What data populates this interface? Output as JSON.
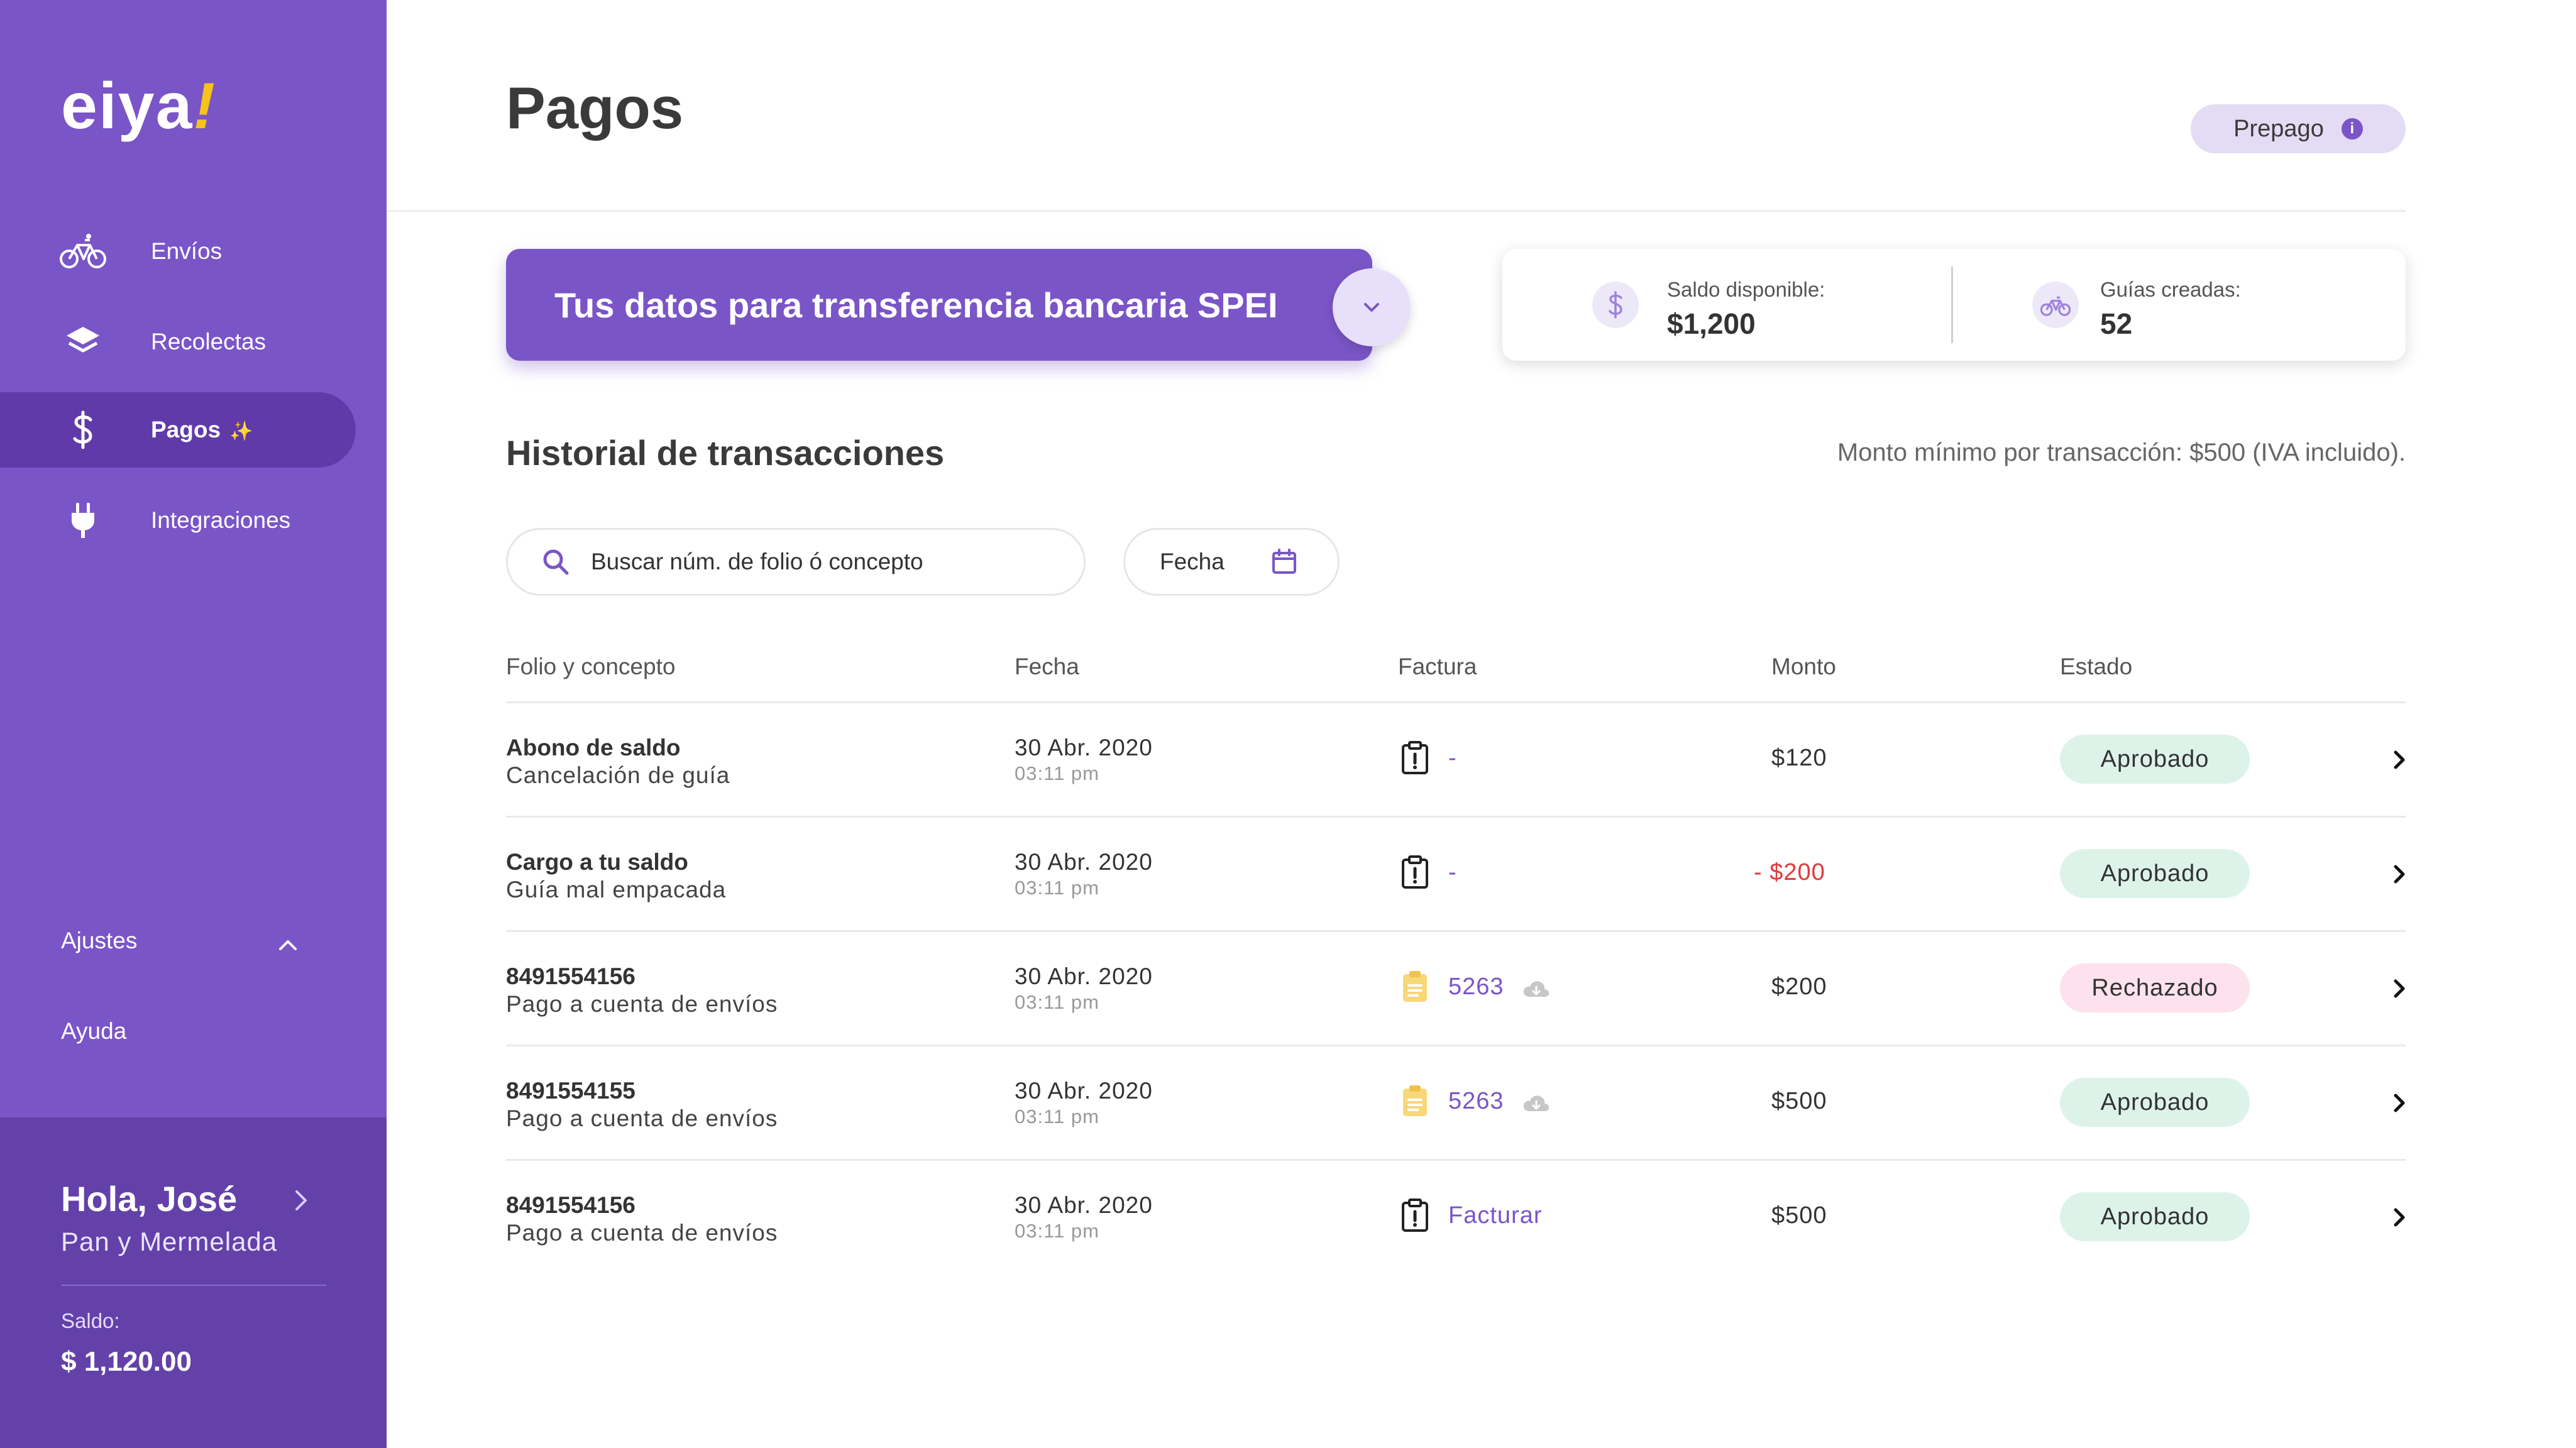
{
  "brand": {
    "logo_text": "eiya",
    "logo_mark": "!"
  },
  "sidebar": {
    "items": [
      {
        "label": "Envíos",
        "icon": "bicycle-icon",
        "active": false
      },
      {
        "label": "Recolectas",
        "icon": "layers-icon",
        "active": false
      },
      {
        "label": "Pagos",
        "icon": "dollar-icon",
        "active": true,
        "badge": "✨"
      },
      {
        "label": "Integraciones",
        "icon": "plug-icon",
        "active": false
      }
    ],
    "settings_label": "Ajustes",
    "help_label": "Ayuda",
    "user": {
      "greeting": "Hola, José",
      "company": "Pan y Mermelada",
      "balance_label": "Saldo:",
      "balance_value": "$ 1,120.00"
    }
  },
  "header": {
    "title": "Pagos",
    "plan_label": "Prepago",
    "plan_info": "i"
  },
  "spei": {
    "label": "Tus datos para transferencia bancaria SPEI"
  },
  "stats": {
    "balance_label": "Saldo disponible:",
    "balance_value": "$1,200",
    "guides_label": "Guías creadas:",
    "guides_value": "52"
  },
  "history": {
    "title": "Historial de transacciones",
    "min_note": "Monto mínimo por transacción: $500 (IVA incluido).",
    "search_placeholder": "Buscar núm. de folio ó concepto",
    "date_filter_label": "Fecha",
    "columns": [
      "Folio y concepto",
      "Fecha",
      "Factura",
      "Monto",
      "Estado"
    ],
    "rows": [
      {
        "folio": "Abono de saldo",
        "concept": "Cancelación de guía",
        "date": "30 Abr. 2020",
        "time": "03:11 pm",
        "invoice": "-",
        "invoice_icon": "clipboard-alert-icon",
        "cloud": false,
        "amount": "$120",
        "negative": false,
        "status": "Aprobado",
        "status_type": "ok"
      },
      {
        "folio": "Cargo a tu saldo",
        "concept": "Guía mal empacada",
        "date": "30 Abr. 2020",
        "time": "03:11 pm",
        "invoice": "-",
        "invoice_icon": "clipboard-alert-icon",
        "cloud": false,
        "amount": "- $200",
        "negative": true,
        "status": "Aprobado",
        "status_type": "ok"
      },
      {
        "folio": "8491554156",
        "concept": "Pago a cuenta de envíos",
        "date": "30 Abr. 2020",
        "time": "03:11 pm",
        "invoice": "5263",
        "invoice_icon": "clipboard-doc-icon",
        "cloud": true,
        "amount": "$200",
        "negative": false,
        "status": "Rechazado",
        "status_type": "bad"
      },
      {
        "folio": "8491554155",
        "concept": "Pago a cuenta de envíos",
        "date": "30 Abr. 2020",
        "time": "03:11 pm",
        "invoice": "5263",
        "invoice_icon": "clipboard-doc-icon",
        "cloud": true,
        "amount": "$500",
        "negative": false,
        "status": "Aprobado",
        "status_type": "ok"
      },
      {
        "folio": "8491554156",
        "concept": "Pago a cuenta de envíos",
        "date": "30 Abr. 2020",
        "time": "03:11 pm",
        "invoice": "Facturar",
        "invoice_icon": "clipboard-alert-icon",
        "cloud": false,
        "amount": "$500",
        "negative": false,
        "status": "Aprobado",
        "status_type": "ok"
      }
    ]
  },
  "colors": {
    "brand_purple": "#7a55c7",
    "brand_purple_dark": "#5f3aa8",
    "accent_yellow": "#f6c31b",
    "approved_bg": "#ddf3ea",
    "rejected_bg": "#fde1ec",
    "negative_amount": "#e03a3a"
  }
}
